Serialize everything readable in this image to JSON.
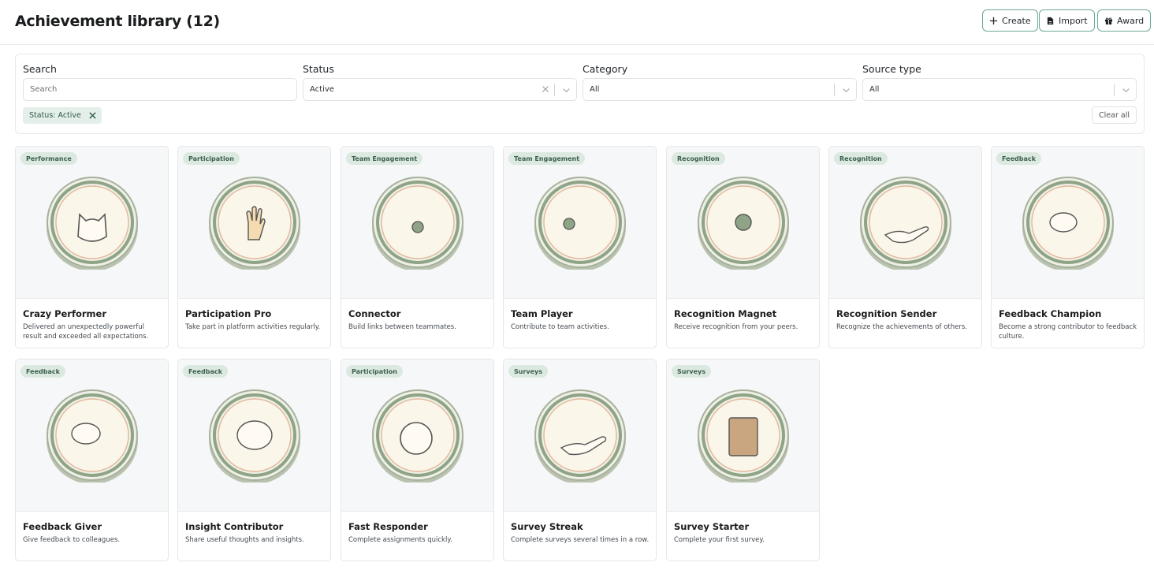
{
  "header": {
    "title": "Achievement library (12)",
    "buttons": [
      {
        "label": "Create",
        "icon": "plus-icon"
      },
      {
        "label": "Import",
        "icon": "file-icon"
      },
      {
        "label": "Award",
        "icon": "gift-icon"
      }
    ]
  },
  "filters": {
    "search": {
      "label": "Search",
      "placeholder": "Search",
      "value": ""
    },
    "status": {
      "label": "Status",
      "value": "Active"
    },
    "category": {
      "label": "Category",
      "value": "All"
    },
    "source_type": {
      "label": "Source type",
      "value": "All"
    },
    "active_chip": "Status: Active",
    "clear_all_label": "Clear all"
  },
  "colors": {
    "accent": "#6aa89a",
    "badge_bg": "#dce9e0",
    "badge_text": "#3b5f4d",
    "medal_green": "#8fa386"
  },
  "achievements": [
    {
      "category": "Performance",
      "title": "Crazy Performer",
      "description": "Delivered an unexpectedly powerful result and exceeded all expectations.",
      "icon": "cat-icon"
    },
    {
      "category": "Participation",
      "title": "Participation Pro",
      "description": "Take part in platform activities regularly.",
      "icon": "raised-hand-icon"
    },
    {
      "category": "Team Engagement",
      "title": "Connector",
      "description": "Build links between teammates.",
      "icon": "network-icon"
    },
    {
      "category": "Team Engagement",
      "title": "Team Player",
      "description": "Contribute to team activities.",
      "icon": "team-icon"
    },
    {
      "category": "Recognition",
      "title": "Recognition Magnet",
      "description": "Receive recognition from your peers.",
      "icon": "person-sparkle-icon"
    },
    {
      "category": "Recognition",
      "title": "Recognition Sender",
      "description": "Recognize the achievements of others.",
      "icon": "giving-hand-icon"
    },
    {
      "category": "Feedback",
      "title": "Feedback Champion",
      "description": "Become a strong contributor to feedback culture.",
      "icon": "chat-laurel-icon"
    },
    {
      "category": "Feedback",
      "title": "Feedback Giver",
      "description": "Give feedback to colleagues.",
      "icon": "chat-bubbles-icon"
    },
    {
      "category": "Feedback",
      "title": "Insight Contributor",
      "description": "Share useful thoughts and insights.",
      "icon": "lightbulb-bubble-icon"
    },
    {
      "category": "Participation",
      "title": "Fast Responder",
      "description": "Complete assignments quickly.",
      "icon": "stopwatch-icon"
    },
    {
      "category": "Surveys",
      "title": "Survey Streak",
      "description": "Complete surveys several times in a row.",
      "icon": "hand-sparkle-icon"
    },
    {
      "category": "Surveys",
      "title": "Survey Starter",
      "description": "Complete your first survey.",
      "icon": "clipboard-icon"
    }
  ]
}
